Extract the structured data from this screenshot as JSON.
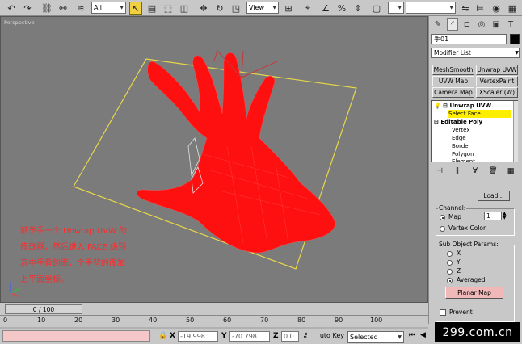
{
  "toolbar": {
    "selection_filter": "All",
    "ref_coord": "View",
    "icons": [
      "undo-icon",
      "redo-icon",
      "link-icon",
      "unlink-icon",
      "bind-spacewarp-icon",
      "select-icon",
      "select-by-name-icon",
      "region-select-icon",
      "window-crossing-icon",
      "move-icon",
      "rotate-icon",
      "scale-icon",
      "pivot-icon",
      "snap-icon",
      "angle-snap-icon",
      "percent-snap-icon",
      "spinner-snap-icon",
      "mirror-icon",
      "align-icon",
      "named-selection-icon",
      "material-editor-icon",
      "render-icon"
    ]
  },
  "viewport": {
    "label": "Perspective",
    "annotation_lines": [
      "赋予手一个 Unwrap UVW 的",
      "修改器，然后进入 FACE 级别",
      "选中手背的面，个手背的面加",
      "上平面坐标。"
    ],
    "colors": {
      "background": "#7b7b7b",
      "mesh": "#ff1010",
      "gizmo": "#e8d848",
      "annotation": "#ff2a2a"
    }
  },
  "command_panel": {
    "tabs": [
      "create-tab-icon",
      "modify-tab-icon",
      "hierarchy-tab-icon",
      "motion-tab-icon",
      "display-tab-icon",
      "utilities-tab-icon"
    ],
    "object_name": "手01",
    "modifier_list": "Modifier List",
    "modifier_buttons": [
      "MeshSmooth",
      "Unwrap UVW",
      "UVW Map",
      "VertexPaint",
      "Camera Map",
      "XScaler (W)"
    ],
    "stack": [
      {
        "label": "Unwrap UVW",
        "bold": true,
        "highlight": false,
        "indent": 0
      },
      {
        "label": "Select Face",
        "bold": false,
        "highlight": true,
        "indent": 1
      },
      {
        "label": "Editable Poly",
        "bold": true,
        "highlight": false,
        "indent": 0
      },
      {
        "label": "Vertex",
        "bold": false,
        "highlight": false,
        "indent": 1
      },
      {
        "label": "Edge",
        "bold": false,
        "highlight": false,
        "indent": 1
      },
      {
        "label": "Border",
        "bold": false,
        "highlight": false,
        "indent": 1
      },
      {
        "label": "Polygon",
        "bold": false,
        "highlight": false,
        "indent": 1
      },
      {
        "label": "Element",
        "bold": false,
        "highlight": false,
        "indent": 1
      }
    ],
    "params": {
      "load_button": "Load...",
      "channel_title": "Channel:",
      "map_label": "Map",
      "map_channel": "1",
      "vertex_color_label": "Vertex Color",
      "sub_object_title": "Sub Object Params:",
      "axes": [
        "X",
        "Y",
        "Z",
        "Averaged"
      ],
      "planar_map_button": "Planar Map",
      "prevent_label": "Prevent"
    }
  },
  "timeline": {
    "frame_display": "0 / 100",
    "ticks": [
      "0",
      "10",
      "20",
      "30",
      "40",
      "50",
      "60",
      "70",
      "80",
      "90",
      "100"
    ]
  },
  "status": {
    "x_label": "X",
    "x_value": "-19.998",
    "y_label": "Y",
    "y_value": "-70.798",
    "z_label": "Z",
    "z_value": "0.0",
    "auto_key": "Auto Key",
    "selected": "Selected",
    "watermark": "299.com.cn"
  }
}
